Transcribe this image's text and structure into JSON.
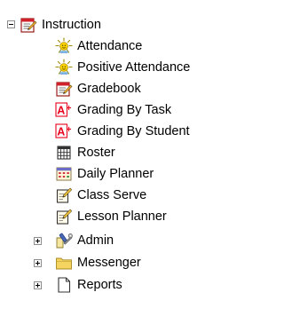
{
  "tree": {
    "root": {
      "label": "Instruction",
      "expanded": true,
      "icon": "gradebook-icon",
      "children": [
        {
          "label": "Attendance",
          "icon": "sun-icon"
        },
        {
          "label": "Positive Attendance",
          "icon": "sun-icon"
        },
        {
          "label": "Gradebook",
          "icon": "gradebook-icon"
        },
        {
          "label": "Grading By Task",
          "icon": "grade-a-plus-icon"
        },
        {
          "label": "Grading By Student",
          "icon": "grade-a-plus-icon"
        },
        {
          "label": "Roster",
          "icon": "roster-grid-icon"
        },
        {
          "label": "Daily Planner",
          "icon": "calendar-icon"
        },
        {
          "label": "Class Serve",
          "icon": "notepad-pencil-icon"
        },
        {
          "label": "Lesson Planner",
          "icon": "notepad-pencil-icon"
        }
      ]
    },
    "siblings": [
      {
        "label": "Admin",
        "expanded": false,
        "icon": "admin-tools-icon"
      },
      {
        "label": "Messenger",
        "expanded": false,
        "icon": "folder-icon"
      },
      {
        "label": "Reports",
        "expanded": false,
        "icon": "document-icon"
      }
    ]
  },
  "colors": {
    "text": "#000000",
    "expander_border": "#8c8c8c",
    "grade_red": "#e8001c",
    "folder_yellow": "#f5d461",
    "gradebook_red": "#d0202a"
  }
}
